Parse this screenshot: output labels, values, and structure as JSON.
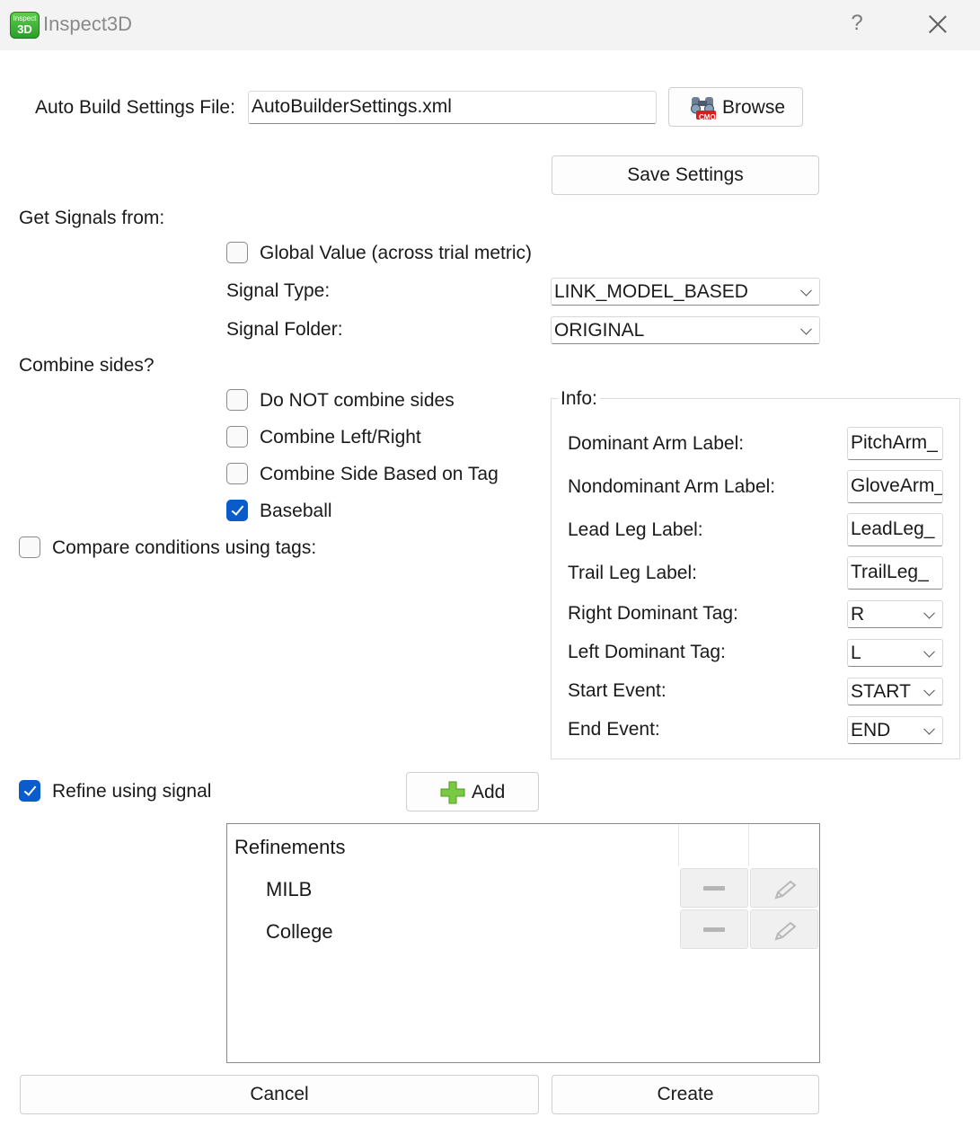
{
  "window": {
    "title": "Inspect3D",
    "icon_top": "Inspect",
    "icon_bottom": "3D",
    "help": "?"
  },
  "settings_file": {
    "label": "Auto Build Settings File:",
    "value": "AutoBuilderSettings.xml",
    "browse_label": "Browse",
    "browse_icon_text": "CMO"
  },
  "save_label": "Save Settings",
  "signals": {
    "heading": "Get Signals from:",
    "global_value": {
      "label": "Global Value (across trial metric)",
      "checked": false
    },
    "signal_type": {
      "label": "Signal Type:",
      "value": "LINK_MODEL_BASED"
    },
    "signal_folder": {
      "label": "Signal Folder:",
      "value": "ORIGINAL"
    }
  },
  "combine": {
    "heading": "Combine sides?",
    "options": [
      {
        "label": "Do NOT combine sides",
        "checked": false
      },
      {
        "label": "Combine Left/Right",
        "checked": false
      },
      {
        "label": "Combine Side Based on Tag",
        "checked": false
      },
      {
        "label": "Baseball",
        "checked": true
      }
    ]
  },
  "compare": {
    "label": "Compare conditions using tags:",
    "checked": false
  },
  "info": {
    "title": "Info:",
    "fields": [
      {
        "label": "Dominant Arm Label:",
        "value": "PitchArm_"
      },
      {
        "label": "Nondominant Arm Label:",
        "value": "GloveArm_"
      },
      {
        "label": "Lead Leg Label:",
        "value": "LeadLeg_"
      },
      {
        "label": "Trail Leg Label:",
        "value": "TrailLeg_"
      }
    ],
    "selects": [
      {
        "label": "Right Dominant Tag:",
        "value": "R"
      },
      {
        "label": "Left Dominant Tag:",
        "value": "L"
      },
      {
        "label": "Start Event:",
        "value": "START"
      },
      {
        "label": "End Event:",
        "value": "END"
      }
    ]
  },
  "refine": {
    "label": "Refine using signal",
    "checked": true,
    "add_label": "Add",
    "list_header": "Refinements",
    "items": [
      "MILB",
      "College"
    ]
  },
  "footer": {
    "cancel_label": "Cancel",
    "create_label": "Create"
  },
  "colors": {
    "accent": "#0a5ccc",
    "add_icon": "#7ac943"
  }
}
